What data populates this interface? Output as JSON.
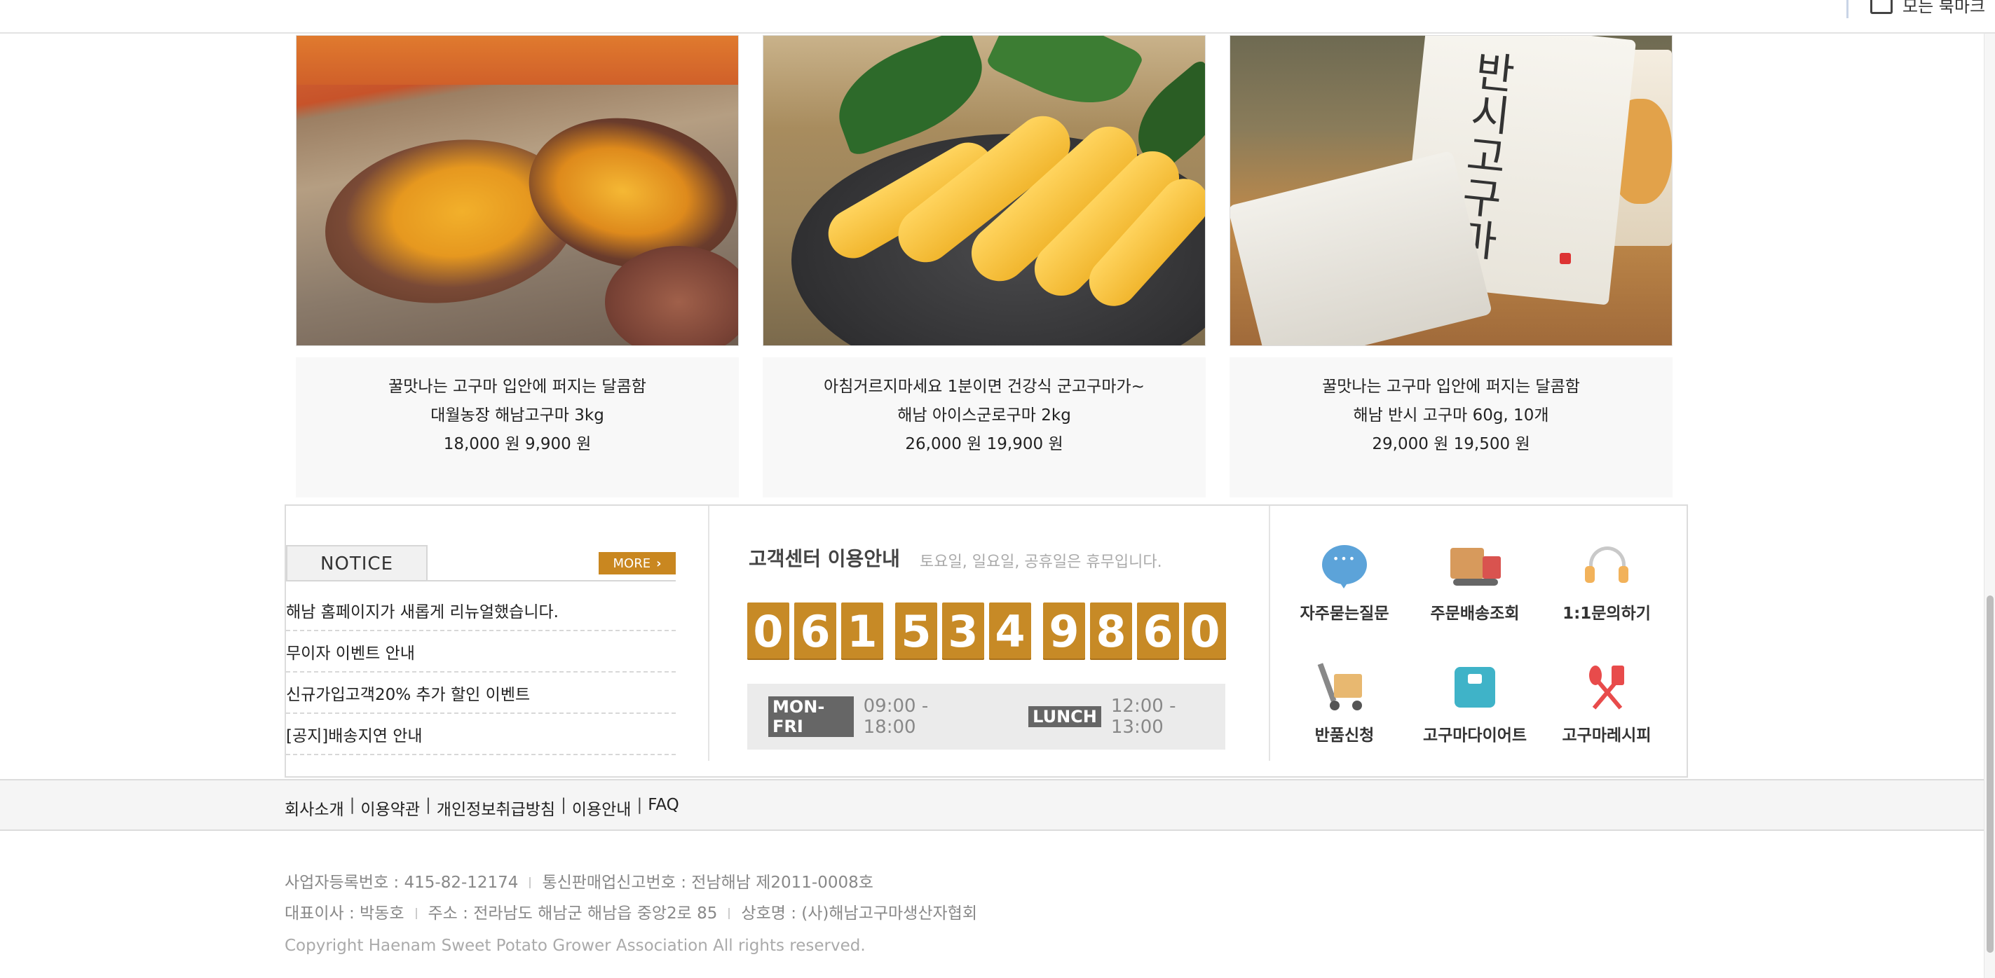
{
  "browser": {
    "bookmarks_label": "모든 북마크",
    "folder_icon": "folder-icon"
  },
  "products": [
    {
      "line1": "꿀맛나는 고구마 입안에 퍼지는 달콤함",
      "line2": "대월농장 해남고구마 3kg",
      "price": "18,000 원 9,900 원"
    },
    {
      "line1": "아침거르지마세요 1분이면 건강식 군고구마가~",
      "line2": "해남 아이스군로구마 2kg",
      "price": "26,000 원 19,900 원"
    },
    {
      "line1": "꿀맛나는 고구마 입안에 퍼지는 달콤함",
      "line2": "해남 반시 고구마 60g, 10개",
      "price": "29,000 원 19,500 원",
      "package_text": "반시고구마"
    }
  ],
  "notice": {
    "title": "NOTICE",
    "more_label": "MORE",
    "items": [
      "해남 홈페이지가 새롭게 리뉴얼했습니다.",
      "무이자 이벤트 안내",
      "신규가입고객20% 추가 할인 이벤트",
      "[공지]배송지연 안내"
    ]
  },
  "customer_center": {
    "title": "고객센터 이용안내",
    "subtitle": "토요일, 일요일, 공휴일은 휴무입니다.",
    "phone_digits": [
      "0",
      "6",
      "1",
      "5",
      "3",
      "4",
      "9",
      "8",
      "6",
      "0"
    ],
    "weekday_tag": "MON-FRI",
    "weekday_hours": "09:00 - 18:00",
    "lunch_tag": "LUNCH",
    "lunch_hours": "12:00 - 13:00"
  },
  "quick_menu": [
    {
      "label": "자주묻는질문",
      "icon": "chat-bubble-icon"
    },
    {
      "label": "주문배송조회",
      "icon": "delivery-truck-icon"
    },
    {
      "label": "1:1문의하기",
      "icon": "headset-icon"
    },
    {
      "label": "반품신청",
      "icon": "hand-cart-icon"
    },
    {
      "label": "고구마다이어트",
      "icon": "weight-scale-icon"
    },
    {
      "label": "고구마레시피",
      "icon": "spoon-fork-icon"
    }
  ],
  "footer": {
    "links": [
      "회사소개",
      "이용약관",
      "개인정보취급방침",
      "이용안내",
      "FAQ"
    ],
    "biz_reg": "사업자등록번호 : 415-82-12174",
    "mail_order": "통신판매업신고번호 : 전남해남 제2011-0008호",
    "ceo": "대표이사 : 박동호",
    "address": "주소 : 전라남도 해남군 해남읍 중앙2로 85",
    "company": "상호명 : (사)해남고구마생산자협회",
    "copyright": "Copyright Haenam Sweet Potato Grower Association All rights reserved."
  },
  "colors": {
    "accent": "#c78a26",
    "notice_more": "#c98720",
    "footer_bg": "#f5f5f5"
  }
}
